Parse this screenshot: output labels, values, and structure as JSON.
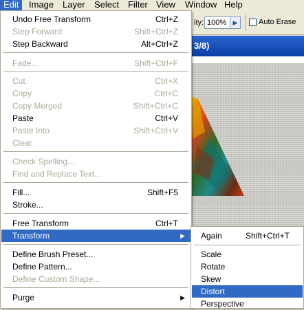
{
  "menubar": {
    "items": [
      {
        "label": "Edit"
      },
      {
        "label": "Image"
      },
      {
        "label": "Layer"
      },
      {
        "label": "Select"
      },
      {
        "label": "Filter"
      },
      {
        "label": "View"
      },
      {
        "label": "Window"
      },
      {
        "label": "Help"
      }
    ]
  },
  "options_bar": {
    "opacity_label_fragment": "ity:",
    "opacity_value": "100%",
    "auto_erase_label": "Auto Erase"
  },
  "document": {
    "title_fragment": "3/8)"
  },
  "edit_menu": {
    "items": [
      {
        "label": "Undo Free Transform",
        "shortcut": "Ctrl+Z"
      },
      {
        "label": "Step Forward",
        "shortcut": "Shift+Ctrl+Z"
      },
      {
        "label": "Step Backward",
        "shortcut": "Alt+Ctrl+Z"
      },
      {
        "label": "Fade...",
        "shortcut": "Shift+Ctrl+F"
      },
      {
        "label": "Cut",
        "shortcut": "Ctrl+X"
      },
      {
        "label": "Copy",
        "shortcut": "Ctrl+C"
      },
      {
        "label": "Copy Merged",
        "shortcut": "Shift+Ctrl+C"
      },
      {
        "label": "Paste",
        "shortcut": "Ctrl+V"
      },
      {
        "label": "Paste Into",
        "shortcut": "Shift+Ctrl+V"
      },
      {
        "label": "Clear",
        "shortcut": ""
      },
      {
        "label": "Check Spelling...",
        "shortcut": ""
      },
      {
        "label": "Find and Replace Text...",
        "shortcut": ""
      },
      {
        "label": "Fill...",
        "shortcut": "Shift+F5"
      },
      {
        "label": "Stroke...",
        "shortcut": ""
      },
      {
        "label": "Free Transform",
        "shortcut": "Ctrl+T"
      },
      {
        "label": "Transform",
        "shortcut": ""
      },
      {
        "label": "Define Brush Preset...",
        "shortcut": ""
      },
      {
        "label": "Define Pattern...",
        "shortcut": ""
      },
      {
        "label": "Define Custom Shape...",
        "shortcut": ""
      },
      {
        "label": "Purge",
        "shortcut": ""
      }
    ]
  },
  "transform_submenu": {
    "items": [
      {
        "label": "Again",
        "shortcut": "Shift+Ctrl+T"
      },
      {
        "label": "Scale",
        "shortcut": ""
      },
      {
        "label": "Rotate",
        "shortcut": ""
      },
      {
        "label": "Skew",
        "shortcut": ""
      },
      {
        "label": "Distort",
        "shortcut": ""
      },
      {
        "label": "Perspective",
        "shortcut": ""
      }
    ]
  },
  "colors": {
    "highlight": "#316ac5",
    "disabled_text": "#aca899",
    "menu_bg": "#ffffff",
    "chrome_bg": "#ece9d8"
  }
}
